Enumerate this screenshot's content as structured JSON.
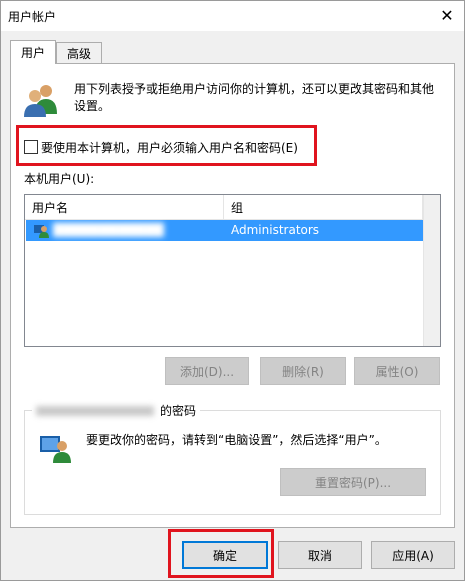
{
  "window": {
    "title": "用户帐户",
    "close_glyph": "✕"
  },
  "tabs": [
    {
      "label": "用户",
      "active": true
    },
    {
      "label": "高级",
      "active": false
    }
  ],
  "description": "用下列表授予或拒绝用户访问你的计算机，还可以更改其密码和其他设置。",
  "require_login_checkbox": {
    "label": "要使用本计算机，用户必须输入用户名和密码(E)",
    "checked": false
  },
  "local_users": {
    "label": "本机用户(U):",
    "columns": [
      "用户名",
      "组"
    ],
    "rows": [
      {
        "username": "████████████",
        "group": "Administrators",
        "selected": true
      }
    ]
  },
  "user_buttons": {
    "add": "添加(D)...",
    "remove": "删除(R)",
    "properties": "属性(O)"
  },
  "password_group": {
    "title_suffix": "的密码",
    "message": "要更改你的密码，请转到“电脑设置”，然后选择“用户”。",
    "reset_button": "重置密码(P)..."
  },
  "dialog_buttons": {
    "ok": "确定",
    "cancel": "取消",
    "apply": "应用(A)"
  },
  "colors": {
    "selection": "#3399ff",
    "highlight_border": "#e0141e",
    "default_button_border": "#0078d7"
  }
}
